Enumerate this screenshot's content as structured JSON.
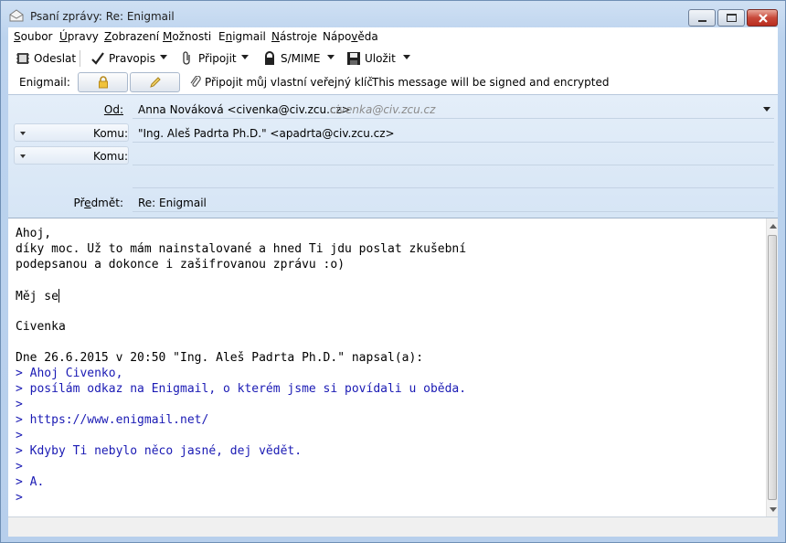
{
  "window": {
    "title": "Psaní zprávy: Re: Enigmail"
  },
  "menu": [
    {
      "pre": "",
      "u": "S",
      "post": "oubor"
    },
    {
      "pre": "",
      "u": "Ú",
      "post": "pravy"
    },
    {
      "pre": "",
      "u": "Z",
      "post": "obrazení"
    },
    {
      "pre": "",
      "u": "M",
      "post": "ožnosti"
    },
    {
      "pre": "E",
      "u": "n",
      "post": "igmail"
    },
    {
      "pre": "",
      "u": "N",
      "post": "ástroje"
    },
    {
      "pre": "Nápo",
      "u": "v",
      "post": "ěda"
    }
  ],
  "toolbar": {
    "send": "Odeslat",
    "spelling": "Pravopis",
    "attach": "Připojit",
    "smime": "S/MIME",
    "save": "Uložit"
  },
  "enigmail": {
    "label": "Enigmail:",
    "attach_key": "Připojit můj vlastní veřejný klíč",
    "status": "This message will be signed and encrypted"
  },
  "headers": {
    "from_label": "Od:",
    "from_value": "Anna Nováková <civenka@civ.zcu.cz>",
    "from_identity": "civenka@civ.zcu.cz",
    "to1_label": "Komu:",
    "to1_value": "\"Ing. Aleš Padrta Ph.D.\" <apadrta@civ.zcu.cz>",
    "to2_label": "Komu:",
    "to2_value": "",
    "subject_label_pre": "Př",
    "subject_label_u": "e",
    "subject_label_post": "dmět:",
    "subject_value": "Re: Enigmail"
  },
  "body": {
    "lines": [
      {
        "text": "Ahoj,",
        "quote": false
      },
      {
        "text": "díky moc. Už to mám nainstalované a hned Ti jdu poslat zkušební",
        "quote": false
      },
      {
        "text": "podepsanou a dokonce i zašifrovanou zprávu :o)",
        "quote": false
      },
      {
        "text": "",
        "quote": false
      },
      {
        "text": "Měj se",
        "quote": false
      },
      {
        "text": "",
        "quote": false
      },
      {
        "text": "Civenka",
        "quote": false
      },
      {
        "text": "",
        "quote": false
      },
      {
        "text": "Dne 26.6.2015 v 20:50 \"Ing. Aleš Padrta Ph.D.\" napsal(a):",
        "quote": false
      },
      {
        "text": "> Ahoj Civenko,",
        "quote": true
      },
      {
        "text": "> posílám odkaz na Enigmail, o kterém jsme si povídali u oběda.",
        "quote": true
      },
      {
        "text": ">",
        "quote": true
      },
      {
        "text": "> https://www.enigmail.net/",
        "quote": true
      },
      {
        "text": ">",
        "quote": true
      },
      {
        "text": "> Kdyby Ti nebylo něco jasné, dej vědět.",
        "quote": true
      },
      {
        "text": ">",
        "quote": true
      },
      {
        "text": "> A.",
        "quote": true
      },
      {
        "text": ">",
        "quote": true
      }
    ]
  },
  "colors": {
    "quote": "#1a1ab4",
    "chrome": "#bcd3ee"
  }
}
